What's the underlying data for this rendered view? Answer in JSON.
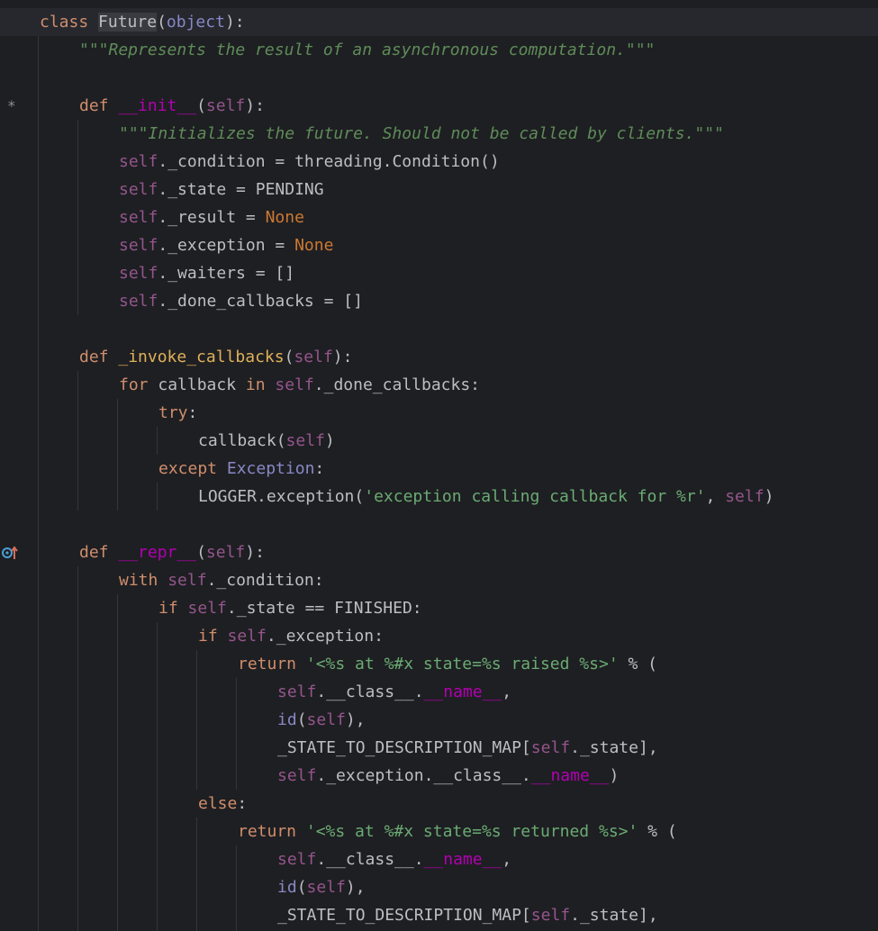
{
  "editor": {
    "gutter_markers": {
      "line1": "*",
      "line4": "*"
    },
    "lines": [
      {
        "id": "l1",
        "tokens": [
          {
            "c": "kw",
            "t": "class"
          },
          {
            "c": "plain",
            "t": " "
          },
          {
            "c": "cls-hl",
            "t": "Future"
          },
          {
            "c": "plain",
            "t": "("
          },
          {
            "c": "builtin",
            "t": "object"
          },
          {
            "c": "plain",
            "t": "):"
          }
        ]
      },
      {
        "id": "l2",
        "tokens": [
          {
            "c": "doc",
            "t": "\"\"\"Represents the result of an asynchronous computation.\"\"\""
          }
        ]
      },
      {
        "id": "l3",
        "tokens": []
      },
      {
        "id": "l4",
        "tokens": [
          {
            "c": "kw",
            "t": "def"
          },
          {
            "c": "plain",
            "t": " "
          },
          {
            "c": "dunder",
            "t": "__init__"
          },
          {
            "c": "plain",
            "t": "("
          },
          {
            "c": "self",
            "t": "self"
          },
          {
            "c": "plain",
            "t": "):"
          }
        ]
      },
      {
        "id": "l5",
        "tokens": [
          {
            "c": "doc",
            "t": "\"\"\"Initializes the future. Should not be called by clients.\"\"\""
          }
        ]
      },
      {
        "id": "l6",
        "tokens": [
          {
            "c": "self",
            "t": "self"
          },
          {
            "c": "plain",
            "t": "._condition = threading.Condition()"
          }
        ]
      },
      {
        "id": "l7",
        "tokens": [
          {
            "c": "self",
            "t": "self"
          },
          {
            "c": "plain",
            "t": "._state = PENDING"
          }
        ]
      },
      {
        "id": "l8",
        "tokens": [
          {
            "c": "self",
            "t": "self"
          },
          {
            "c": "plain",
            "t": "._result = "
          },
          {
            "c": "const",
            "t": "None"
          }
        ]
      },
      {
        "id": "l9",
        "tokens": [
          {
            "c": "self",
            "t": "self"
          },
          {
            "c": "plain",
            "t": "._exception = "
          },
          {
            "c": "const",
            "t": "None"
          }
        ]
      },
      {
        "id": "l10",
        "tokens": [
          {
            "c": "self",
            "t": "self"
          },
          {
            "c": "plain",
            "t": "._waiters = []"
          }
        ]
      },
      {
        "id": "l11",
        "tokens": [
          {
            "c": "self",
            "t": "self"
          },
          {
            "c": "plain",
            "t": "._done_callbacks = []"
          }
        ]
      },
      {
        "id": "l12",
        "tokens": []
      },
      {
        "id": "l13",
        "tokens": [
          {
            "c": "kw",
            "t": "def"
          },
          {
            "c": "plain",
            "t": " "
          },
          {
            "c": "fn",
            "t": "_invoke_callbacks"
          },
          {
            "c": "plain",
            "t": "("
          },
          {
            "c": "self",
            "t": "self"
          },
          {
            "c": "plain",
            "t": "):"
          }
        ]
      },
      {
        "id": "l14",
        "tokens": [
          {
            "c": "kw",
            "t": "for"
          },
          {
            "c": "plain",
            "t": " callback "
          },
          {
            "c": "kw",
            "t": "in"
          },
          {
            "c": "plain",
            "t": " "
          },
          {
            "c": "self",
            "t": "self"
          },
          {
            "c": "plain",
            "t": "._done_callbacks:"
          }
        ]
      },
      {
        "id": "l15",
        "tokens": [
          {
            "c": "kw",
            "t": "try"
          },
          {
            "c": "plain",
            "t": ":"
          }
        ]
      },
      {
        "id": "l16",
        "tokens": [
          {
            "c": "plain",
            "t": "callback("
          },
          {
            "c": "self",
            "t": "self"
          },
          {
            "c": "plain",
            "t": ")"
          }
        ]
      },
      {
        "id": "l17",
        "tokens": [
          {
            "c": "kw",
            "t": "except"
          },
          {
            "c": "plain",
            "t": " "
          },
          {
            "c": "builtin",
            "t": "Exception"
          },
          {
            "c": "plain",
            "t": ":"
          }
        ]
      },
      {
        "id": "l18",
        "tokens": [
          {
            "c": "plain",
            "t": "LOGGER.exception("
          },
          {
            "c": "str",
            "t": "'exception calling callback for %r'"
          },
          {
            "c": "plain",
            "t": ", "
          },
          {
            "c": "self",
            "t": "self"
          },
          {
            "c": "plain",
            "t": ")"
          }
        ]
      },
      {
        "id": "l19",
        "tokens": []
      },
      {
        "id": "l20",
        "tokens": [
          {
            "c": "kw",
            "t": "def"
          },
          {
            "c": "plain",
            "t": " "
          },
          {
            "c": "dunder",
            "t": "__repr__"
          },
          {
            "c": "plain",
            "t": "("
          },
          {
            "c": "self",
            "t": "self"
          },
          {
            "c": "plain",
            "t": "):"
          }
        ]
      },
      {
        "id": "l21",
        "tokens": [
          {
            "c": "kw",
            "t": "with"
          },
          {
            "c": "plain",
            "t": " "
          },
          {
            "c": "self",
            "t": "self"
          },
          {
            "c": "plain",
            "t": "._condition:"
          }
        ]
      },
      {
        "id": "l22",
        "tokens": [
          {
            "c": "kw",
            "t": "if"
          },
          {
            "c": "plain",
            "t": " "
          },
          {
            "c": "self",
            "t": "self"
          },
          {
            "c": "plain",
            "t": "._state == FINISHED:"
          }
        ]
      },
      {
        "id": "l23",
        "tokens": [
          {
            "c": "kw",
            "t": "if"
          },
          {
            "c": "plain",
            "t": " "
          },
          {
            "c": "self",
            "t": "self"
          },
          {
            "c": "plain",
            "t": "._exception:"
          }
        ]
      },
      {
        "id": "l24",
        "tokens": [
          {
            "c": "kw",
            "t": "return"
          },
          {
            "c": "plain",
            "t": " "
          },
          {
            "c": "str",
            "t": "'<%s at %#x state=%s raised %s>'"
          },
          {
            "c": "plain",
            "t": " % ("
          }
        ]
      },
      {
        "id": "l25",
        "tokens": [
          {
            "c": "self",
            "t": "self"
          },
          {
            "c": "plain",
            "t": ".__class__."
          },
          {
            "c": "dunder",
            "t": "__name__"
          },
          {
            "c": "plain",
            "t": ","
          }
        ]
      },
      {
        "id": "l26",
        "tokens": [
          {
            "c": "builtin",
            "t": "id"
          },
          {
            "c": "plain",
            "t": "("
          },
          {
            "c": "self",
            "t": "self"
          },
          {
            "c": "plain",
            "t": "),"
          }
        ]
      },
      {
        "id": "l27",
        "tokens": [
          {
            "c": "plain",
            "t": "_STATE_TO_DESCRIPTION_MAP["
          },
          {
            "c": "self",
            "t": "self"
          },
          {
            "c": "plain",
            "t": "._state],"
          }
        ]
      },
      {
        "id": "l28",
        "tokens": [
          {
            "c": "self",
            "t": "self"
          },
          {
            "c": "plain",
            "t": "._exception.__class__."
          },
          {
            "c": "dunder",
            "t": "__name__"
          },
          {
            "c": "plain",
            "t": ")"
          }
        ]
      },
      {
        "id": "l29",
        "tokens": [
          {
            "c": "kw",
            "t": "else"
          },
          {
            "c": "plain",
            "t": ":"
          }
        ]
      },
      {
        "id": "l30",
        "tokens": [
          {
            "c": "kw",
            "t": "return"
          },
          {
            "c": "plain",
            "t": " "
          },
          {
            "c": "str",
            "t": "'<%s at %#x state=%s returned %s>'"
          },
          {
            "c": "plain",
            "t": " % ("
          }
        ]
      },
      {
        "id": "l31",
        "tokens": [
          {
            "c": "self",
            "t": "self"
          },
          {
            "c": "plain",
            "t": ".__class__."
          },
          {
            "c": "dunder",
            "t": "__name__"
          },
          {
            "c": "plain",
            "t": ","
          }
        ]
      },
      {
        "id": "l32",
        "tokens": [
          {
            "c": "builtin",
            "t": "id"
          },
          {
            "c": "plain",
            "t": "("
          },
          {
            "c": "self",
            "t": "self"
          },
          {
            "c": "plain",
            "t": "),"
          }
        ]
      },
      {
        "id": "l33",
        "tokens": [
          {
            "c": "plain",
            "t": "_STATE_TO_DESCRIPTION_MAP["
          },
          {
            "c": "self",
            "t": "self"
          },
          {
            "c": "plain",
            "t": "._state],"
          }
        ]
      }
    ]
  }
}
